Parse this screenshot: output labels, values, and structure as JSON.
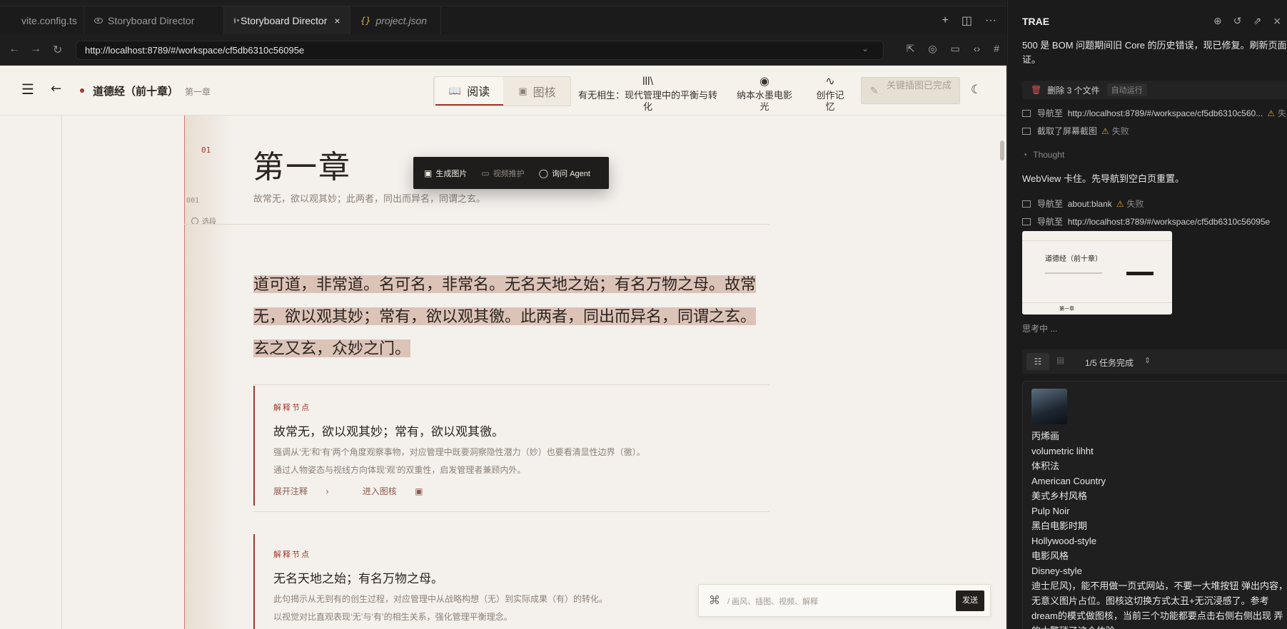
{
  "tabs": [
    {
      "label": "vite.config.ts",
      "type": "ts"
    },
    {
      "label": "Storyboard Director",
      "type": "preview"
    },
    {
      "label": "Storyboard Director",
      "type": "preview",
      "active": true
    },
    {
      "label": "project.json",
      "type": "json"
    }
  ],
  "tab_close": "×",
  "address": {
    "url": "http://localhost:8789/#/workspace/cf5db6310c56095e"
  },
  "app": {
    "book_title": "道德经（前十章）",
    "chapter_crumb": "第一章",
    "mode_read": "阅读",
    "mode_grid": "图核",
    "menu1": "有无相生：现代管理中的平衡与转化",
    "menu2": "纳本水墨电影光",
    "menu3": "创作记忆",
    "key_button": "关键插图已完成",
    "chapter_no": "01",
    "para_no": "001",
    "select_label": "选段",
    "chapter_title": "第一章",
    "chapter_subtitle": "故常无，欲以观其妙；此两者，同出而异名，同谓之玄。",
    "main_line1": "道可道，非常道。名可名，非常名。无名天地之始；有名万物之母。故常",
    "main_line2": "无，欲以观其妙；常有，欲以观其徼。此两者，同出而异名，同谓之玄。",
    "main_line3": "玄之又玄，众妙之门。",
    "popup": {
      "gen_image": "生成图片",
      "video": "视频推护",
      "ask_agent": "询问 Agent"
    },
    "cards": [
      {
        "label": "解释节点",
        "title": "故常无，欲以观其妙；常有，欲以观其徼。",
        "desc1": "强调从‘无’和‘有’两个角度观察事物，对应管理中既要洞察隐性潜力（妙）也要看清显性边界（徼）。",
        "desc2": "通过人物姿态与视线方向体现‘观’的双重性，启发管理者兼顾内外。",
        "act1": "展开注释",
        "act2": "进入图核"
      },
      {
        "label": "解释节点",
        "title": "无名天地之始；有名万物之母。",
        "desc1": "此句揭示从无到有的创生过程，对应管理中从战略构想（无）到实际成果（有）的转化。",
        "desc2": "以视觉对比直观表现‘无’与‘有’的相生关系，强化管理平衡理念。"
      }
    ],
    "cmd_placeholder": "/ 画风、插图、视频、解释",
    "send": "发送"
  },
  "agent": {
    "title": "TRAE",
    "intro": "500 是 BOM 问题期间旧 Core 的历史错误，现已修复。刷新页面验证。",
    "delete_files": "删除 3 个文件",
    "auto_run": "自动运行",
    "step1_label": "导航至",
    "step1_url": "http://localhost:8789/#/workspace/cf5db6310c560...",
    "step1_status": "失败",
    "step2_label": "截取了屏幕截图",
    "step2_status": "失败",
    "thought": "Thought",
    "message2": "WebView 卡住。先导航到空白页重置。",
    "step3_label": "导航至",
    "step3_url": "about:blank",
    "step3_status": "失败",
    "step4_label": "导航至",
    "step4_url": "http://localhost:8789/#/workspace/cf5db6310c56095e",
    "thumb_title": "道德经（前十章）",
    "thumb_chapter": "第一章",
    "thinking": "思考中 ...",
    "task_progress": "1/5 任务完成",
    "style_list": [
      "丙烯画",
      "volumetric lihht",
      "体积法",
      "American Country",
      "美式乡村风格",
      "Pulp Noir",
      "黑白电影时期",
      "Hollywood-style",
      "电影风格",
      "Disney-style"
    ],
    "long_text": "迪士尼风)，能不用做一页式网站，不要一大堆按钮 弹出内容，无意义图片占位。图核这切换方式太丑+无沉浸感了。参考 dream的模式做图核，当前三个功能都要点击右侧右侧出现 弄的太繁琐了这个体验",
    "accent": "#9b3b2f",
    "warn_color": "#d9a531"
  }
}
